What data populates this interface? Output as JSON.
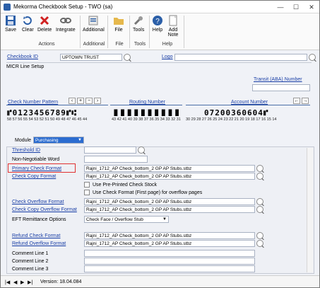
{
  "window": {
    "title": "Mekorma Checkbook Setup  -  TWO (sa)"
  },
  "ribbon": {
    "save": "Save",
    "clear": "Clear",
    "delete": "Delete",
    "integrate": "Integrate",
    "actions_group": "Actions",
    "additional": "Additional",
    "additional_group": "Additional",
    "file": "File",
    "file_group": "File",
    "tools": "Tools",
    "tools_group": "Tools",
    "help": "Help",
    "add_note": "Add Note",
    "help_group": "Help"
  },
  "header": {
    "checkbook_id_label": "Checkbook ID",
    "checkbook_id_value": "UPTOWN TRUST",
    "logo_label": "Logo",
    "micr_label": "MICR Line Setup",
    "transit_label": "Transit (ABA) Number",
    "check_number_label": "Check Number Pattern",
    "routing_label": "Routing Number",
    "account_label": "Account Number",
    "micr_check_chars": "⑈0123456789⑈⑆",
    "micr_routing_chars": "▐▌▐▌▐▌▐▌▐▌▐▌▐▌▐▌▐▌▐▌",
    "micr_account_chars": "07200360604⑈",
    "micr_check_nums": "58 57 56 55 54 53 52 51 50 49 48 47 46 45 44",
    "micr_routing_nums": "43 42 41 40 39 38 37 36 35 34 33 32 31",
    "micr_account_nums": "30 29 28 27 26 25 24 23 22 21 20 19 18 17 16 15 14"
  },
  "module": {
    "label": "Module",
    "value": "Purchasing"
  },
  "fields": {
    "threshold_id": "Threshold ID",
    "non_negotiable": "Non-Negotiable Word",
    "primary_check_format": "Primary Check Format",
    "primary_check_value": "Rajni_1712_AP Check_bottom_2 GP AP Stubs.stbz",
    "check_copy_format": "Check Copy Format",
    "check_copy_value": "Rajni_1712_AP Check_bottom_2 GP AP Stubs.stbz",
    "use_preprinted": "Use Pre-Printed Check Stock",
    "use_check_format": "Use Check Format (First page) for overflow pages",
    "check_overflow_format": "Check Overflow Format",
    "check_overflow_value": "Rajni_1712_AP Check_bottom_2 GP AP Stubs.stbz",
    "check_copy_overflow_format": "Check Copy Overflow Format",
    "check_copy_overflow_value": "Rajni_1712_AP Check_bottom_2 GP AP Stubs.stbz",
    "eft_label": "EFT Remittance Options",
    "eft_value": "Check Face / Overflow Stub",
    "refund_check_format": "Refund Check Format",
    "refund_check_value": "Rajni_1712_AP Check_bottom_2 GP AP Stubs.stbz",
    "refund_overflow_format": "Refund Overflow Format",
    "refund_overflow_value": "Rajni_1712_AP Check_bottom_2 GP AP Stubs.stbz",
    "comment1": "Comment Line 1",
    "comment2": "Comment Line 2",
    "comment3": "Comment Line 3"
  },
  "status": {
    "version": "Version: 18.04.084"
  },
  "colors": {
    "accent": "#1a3fa6",
    "highlight_box": "#e03030"
  }
}
